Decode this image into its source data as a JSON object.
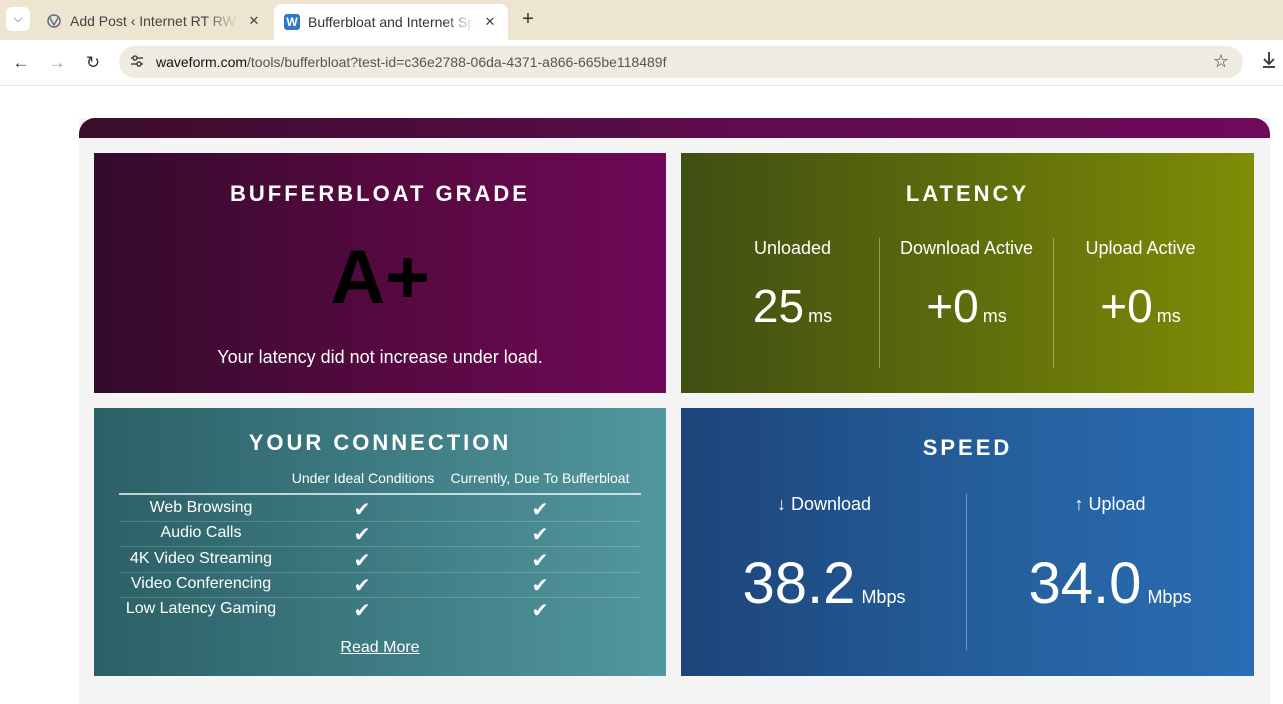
{
  "browser": {
    "tabs": [
      {
        "title": "Add Post ‹ Internet RT RW",
        "close": "✕",
        "active": false
      },
      {
        "title": "Bufferbloat and Internet Speed Test",
        "close": "✕",
        "active": true
      }
    ],
    "new_tab": "+",
    "url_host": "waveform.com",
    "url_path": "/tools/bufferbloat?test-id=c36e2788-06da-4371-a866-665be118489f"
  },
  "grade": {
    "title": "BUFFERBLOAT GRADE",
    "value": "A+",
    "description": "Your latency did not increase under load."
  },
  "latency": {
    "title": "LATENCY",
    "unit": "ms",
    "columns": [
      {
        "label": "Unloaded",
        "value": "25"
      },
      {
        "label": "Download Active",
        "value": "+0"
      },
      {
        "label": "Upload Active",
        "value": "+0"
      }
    ]
  },
  "connection": {
    "title": "YOUR CONNECTION",
    "headers": [
      "Under Ideal Conditions",
      "Currently, Due To Bufferbloat"
    ],
    "check": "✔",
    "rows": [
      {
        "name": "Web Browsing",
        "ideal": true,
        "current": true
      },
      {
        "name": "Audio Calls",
        "ideal": true,
        "current": true
      },
      {
        "name": "4K Video Streaming",
        "ideal": true,
        "current": true
      },
      {
        "name": "Video Conferencing",
        "ideal": true,
        "current": true
      },
      {
        "name": "Low Latency Gaming",
        "ideal": true,
        "current": true
      }
    ],
    "read_more": "Read More"
  },
  "speed": {
    "title": "SPEED",
    "unit": "Mbps",
    "download": {
      "label": "↓ Download",
      "value": "38.2"
    },
    "upload": {
      "label": "↑ Upload",
      "value": "34.0"
    }
  },
  "colors": {
    "grade_panel": "#55093f",
    "latency_panel": "#5e6c0c",
    "connection_panel": "#3e7b82",
    "speed_panel": "#245d99"
  }
}
